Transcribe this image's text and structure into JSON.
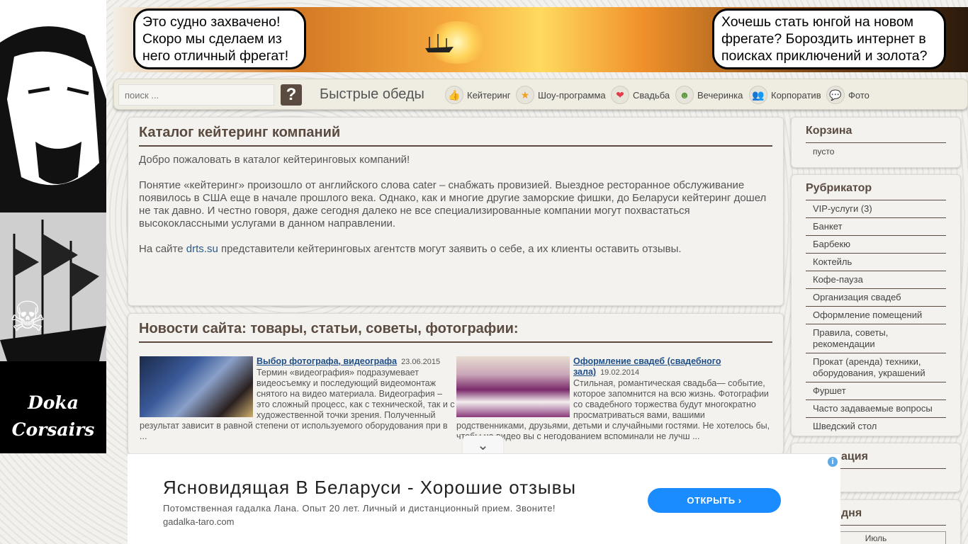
{
  "banner": {
    "left_bubble": "Это судно захвачено! Скоро мы сделаем из него отличный фрегат!",
    "right_bubble": "Хочешь стать юнгой на новом фрегате? Бороздить интернет в поисках приключений и золота?"
  },
  "logo": {
    "line1": "Doka",
    "line2": "Corsairs"
  },
  "nav": {
    "search_placeholder": "поиск ...",
    "search_button": "?",
    "quick_label": "Быстрые обеды",
    "items": [
      {
        "label": "Кейтеринг",
        "icon": "thumbs-up-icon",
        "glyph": "👍"
      },
      {
        "label": "Шоу-программа",
        "icon": "star-icon",
        "glyph": "★"
      },
      {
        "label": "Свадьба",
        "icon": "heart-icon",
        "glyph": "❤"
      },
      {
        "label": "Вечеринка",
        "icon": "person-icon",
        "glyph": "☻"
      },
      {
        "label": "Корпоратив",
        "icon": "group-icon",
        "glyph": "👥"
      },
      {
        "label": "Фото",
        "icon": "chat-icon",
        "glyph": "💬"
      }
    ]
  },
  "intro": {
    "title": "Каталог кейтеринг компаний",
    "p1": "Добро пожаловать в каталог кейтеринговых компаний!",
    "p2": "Понятие «кейтеринг» произошло от английского слова cater – снабжать провизией. Выездное ресторанное обслуживание появилось в США еще в начале прошлого века. Однако, как и многие другие заморские фишки, до Беларуси кейтеринг дошел не так давно. И честно говоря, даже сегодня далеко не все специализированные компании могут похвастаться высококлассными услугами в данном направлении.",
    "p3_before": "На сайте ",
    "p3_link": "drts.su",
    "p3_after": " представители кейтеринговых агентств могут заявить о себе, а их клиенты оставить отзывы."
  },
  "news": {
    "title": "Новости сайта: товары, статьи, советы, фотографии:",
    "articles": [
      {
        "title": "Выбор фотографа, видеографа",
        "date": "23.06.2015",
        "text": "Термин «видеография» подразумевает видеосъемку и последующий видеомонтаж снятого на видео материала. Видеография – это сложный процесс, как с технической, так и с художественной точки зрения. Полученный результат зависит в равной степени от используемого оборудования при в ..."
      },
      {
        "title": "Оформление свадеб (свадебного зала)",
        "date": "19.02.2014",
        "text": "Стильная, романтическая свадьба— событие, которое запомнится на всю жизнь. Фотографии со свадебного торжества будут многократно просматриваться вами, вашими родственниками, друзьями, детьми и случайными гостями. Не хотелось бы, чтобы на видео вы с негодованием вспоминали не лучш ..."
      }
    ]
  },
  "cart": {
    "title": "Корзина",
    "empty": "пусто"
  },
  "rubricator": {
    "title": "Рубрикатор",
    "items": [
      "VIP-услуги (3)",
      "Банкет",
      "Барбекю",
      "Коктейль",
      "Кофе-пауза",
      "Организация свадеб",
      "Оформление помещений",
      "Правила, советы, рекомендации",
      "Прокат (аренда) техники, оборудования, украшений",
      "Фуршет",
      "Часто задаваемые вопросы",
      "Шведский стол"
    ]
  },
  "side3": {
    "title": "ация"
  },
  "side4": {
    "title": "дня",
    "month": "Июль"
  },
  "ad": {
    "title": "Ясновидящая В Беларуси - Хорошие отзывы",
    "desc": "Потомственная гадалка Лана. Опыт 20 лет. Личный и дистанционный прием. Звоните!",
    "domain": "gadalka-taro.com",
    "button": "ОТКРЫТЬ",
    "info": "i",
    "collapse": "⌄"
  },
  "colors": {
    "accent": "#5a4a40",
    "link": "#1f4f88",
    "ad_button": "#1a8cff"
  }
}
